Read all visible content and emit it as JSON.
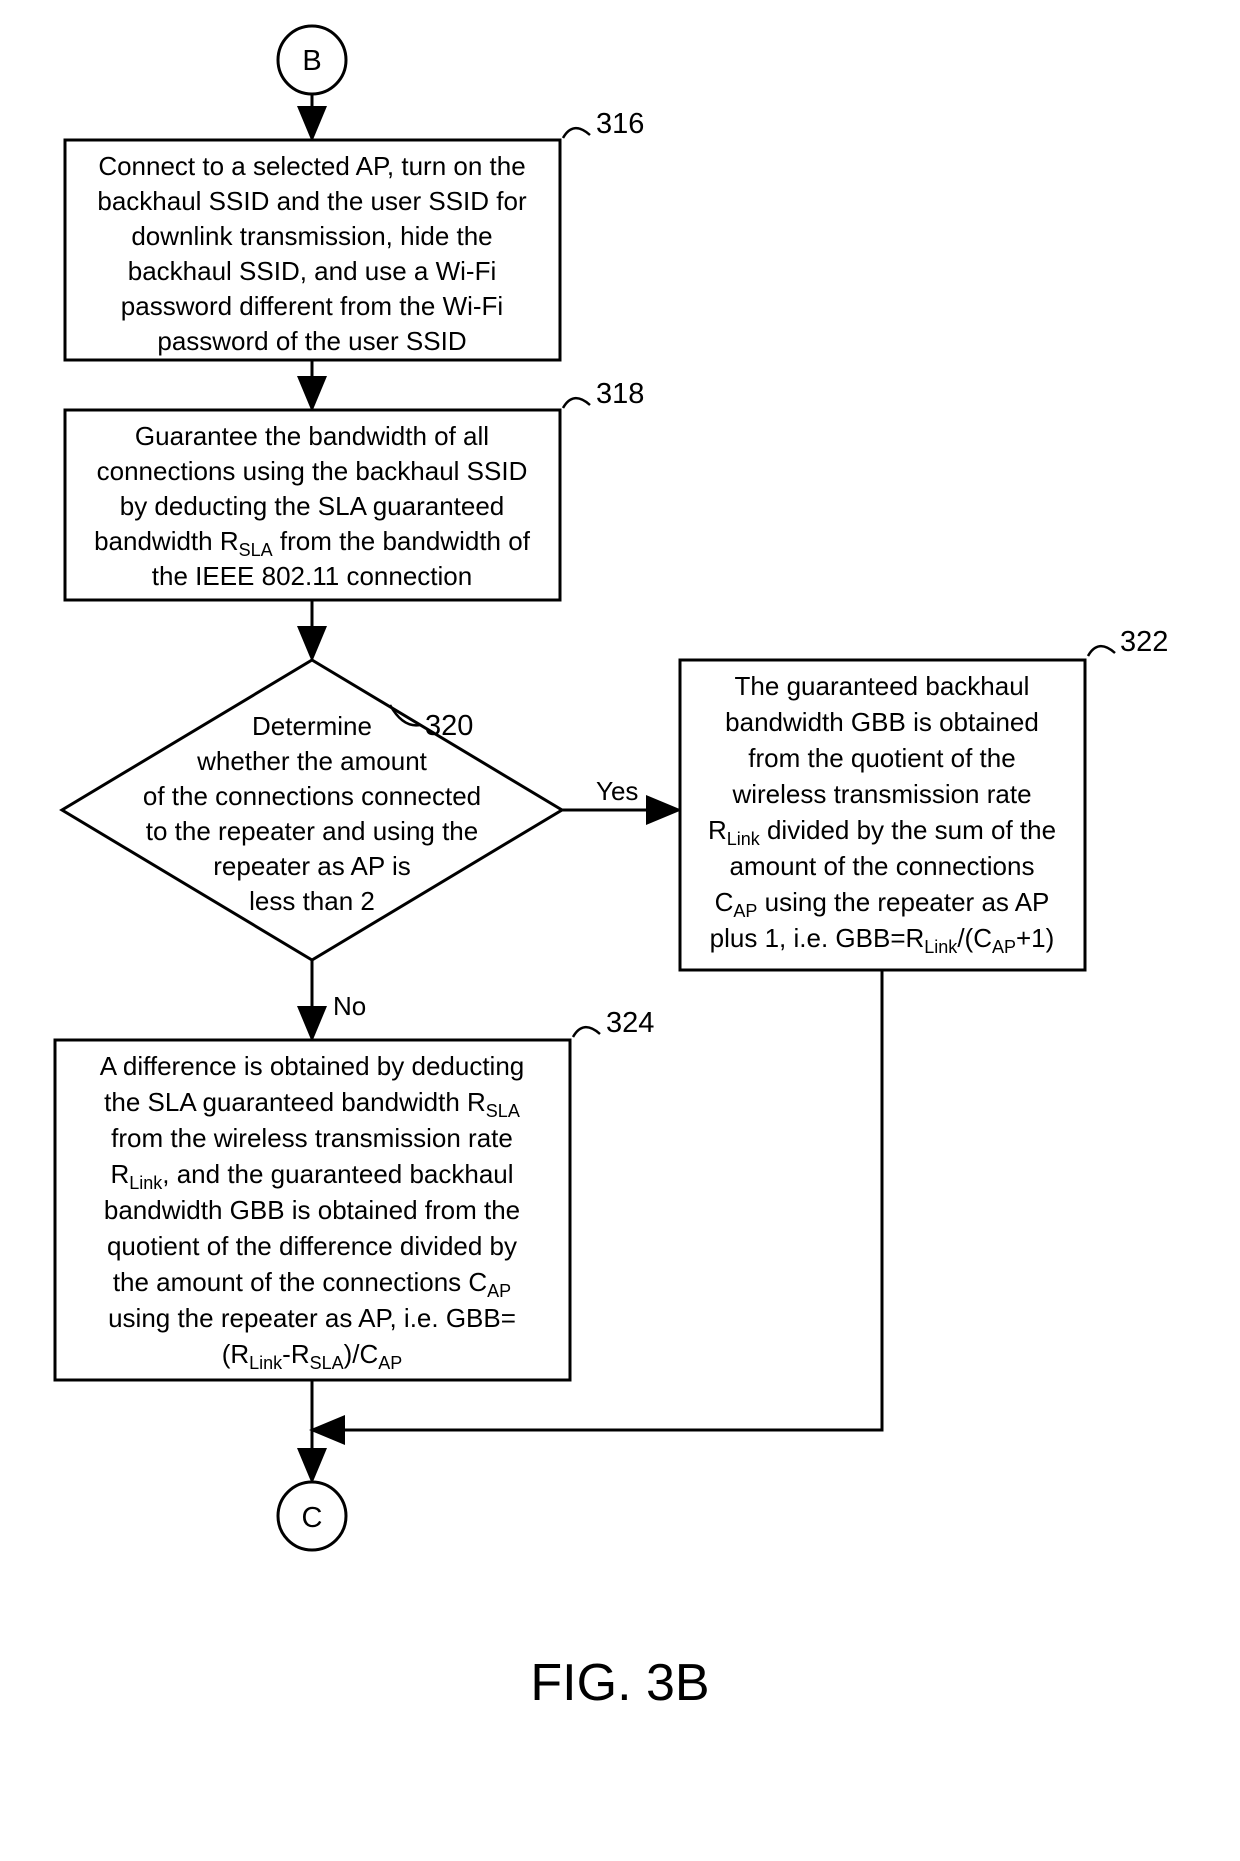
{
  "connectors": {
    "B": "B",
    "C": "C"
  },
  "box316": {
    "label": "316",
    "line1": "Connect to a selected AP, turn on the",
    "line2": "backhaul SSID and the user SSID for",
    "line3": "downlink transmission, hide the",
    "line4": "backhaul SSID, and use a Wi-Fi",
    "line5": "password different from the Wi-Fi",
    "line6": "password of the user SSID"
  },
  "box318": {
    "label": "318",
    "line1": "Guarantee the bandwidth of all",
    "line2": "connections using the backhaul SSID",
    "line3": "by deducting the SLA guaranteed",
    "line4_pre": "bandwidth R",
    "line4_sub": "SLA",
    "line4_post": " from the bandwidth of",
    "line5": "the IEEE 802.11 connection"
  },
  "decision320": {
    "label": "320",
    "line1": "Determine",
    "line2": "whether the amount",
    "line3": "of the connections connected",
    "line4": "to the repeater and using the",
    "line5": "repeater as AP is",
    "line6": "less than 2",
    "yes": "Yes",
    "no": "No"
  },
  "box322": {
    "label": "322",
    "line1": "The guaranteed backhaul",
    "line2": "bandwidth GBB is obtained",
    "line3": "from the quotient of the",
    "line4": "wireless transmission rate",
    "line5_pre": "R",
    "line5_sub": "Link",
    "line5_post": " divided by the sum of the",
    "line6": "amount of the connections",
    "line7_pre": "C",
    "line7_sub": "AP",
    "line7_post": " using the repeater as AP",
    "line8_pre": "plus 1, i.e. GBB=R",
    "line8_sub1": "Link",
    "line8_mid": "/(C",
    "line8_sub2": "AP",
    "line8_post": "+1)"
  },
  "box324": {
    "label": "324",
    "line1": "A difference is obtained by deducting",
    "line2_pre": "the SLA guaranteed bandwidth R",
    "line2_sub": "SLA",
    "line3": "from the wireless transmission rate",
    "line4_pre": "R",
    "line4_sub": "Link",
    "line4_post": ", and the guaranteed backhaul",
    "line5": "bandwidth GBB is obtained from the",
    "line6": "quotient of the difference divided by",
    "line7_pre": "the amount of the connections C",
    "line7_sub": "AP",
    "line8": "using the repeater as AP, i.e. GBB=",
    "line9_pre": "(R",
    "line9_sub1": "Link",
    "line9_mid1": "-R",
    "line9_sub2": "SLA",
    "line9_mid2": ")/C",
    "line9_sub3": "AP"
  },
  "figure_label": "FIG. 3B"
}
